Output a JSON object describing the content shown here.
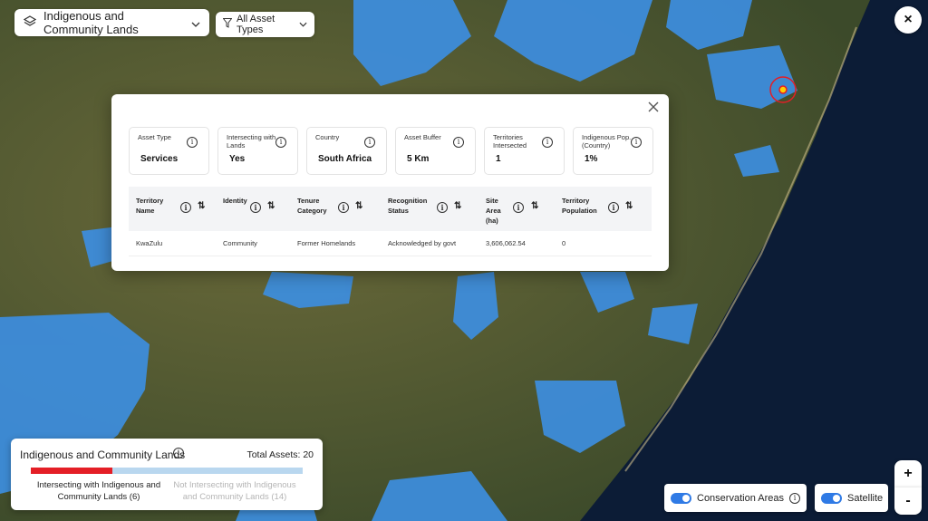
{
  "map": {
    "colors": {
      "land": "#5b6237",
      "land_dark": "#3f4a2a",
      "ocean": "#0b1a33",
      "territory": "#3d8ee0",
      "asset_marker": "#e41e26"
    }
  },
  "controls": {
    "layer_select": {
      "label": "Indigenous and Community Lands",
      "icon": "layers-icon"
    },
    "asset_type_select": {
      "label": "All Asset Types",
      "icon": "filter-icon"
    },
    "close_label": "×"
  },
  "modal": {
    "cards": [
      {
        "label": "Asset Type",
        "value": "Services"
      },
      {
        "label": "Intersecting with Lands",
        "value": "Yes"
      },
      {
        "label": "Country",
        "value": "South Africa"
      },
      {
        "label": "Asset Buffer",
        "value": "5 Km"
      },
      {
        "label": "Territories Intersected",
        "value": "1"
      },
      {
        "label": "Indigenous Pop. (Country)",
        "value": "1%"
      }
    ],
    "table": {
      "columns": [
        "Territory Name",
        "Identity",
        "Tenure Category",
        "Recognition Status",
        "Site Area (ha)",
        "Territory Population"
      ],
      "rows": [
        [
          "KwaZulu",
          "Community",
          "Former Homelands",
          "Acknowledged by govt",
          "3,606,062.54",
          "0"
        ]
      ]
    }
  },
  "legend": {
    "title": "Indigenous and Community Lands",
    "total": "Total Assets: 20",
    "intersecting_label": "Intersecting with Indigenous and Community Lands (6)",
    "not_intersecting_label": "Not Intersecting with Indigenous and Community Lands (14)",
    "intersecting_fraction": 0.3,
    "colors": {
      "intersecting": "#e41e26",
      "not_intersecting": "#b9d7ef"
    }
  },
  "toggles": {
    "conservation": {
      "label": "Conservation Areas",
      "on": true
    },
    "satellite": {
      "label": "Satellite",
      "on": true
    }
  },
  "zoom": {
    "in": "+",
    "out": "-"
  }
}
